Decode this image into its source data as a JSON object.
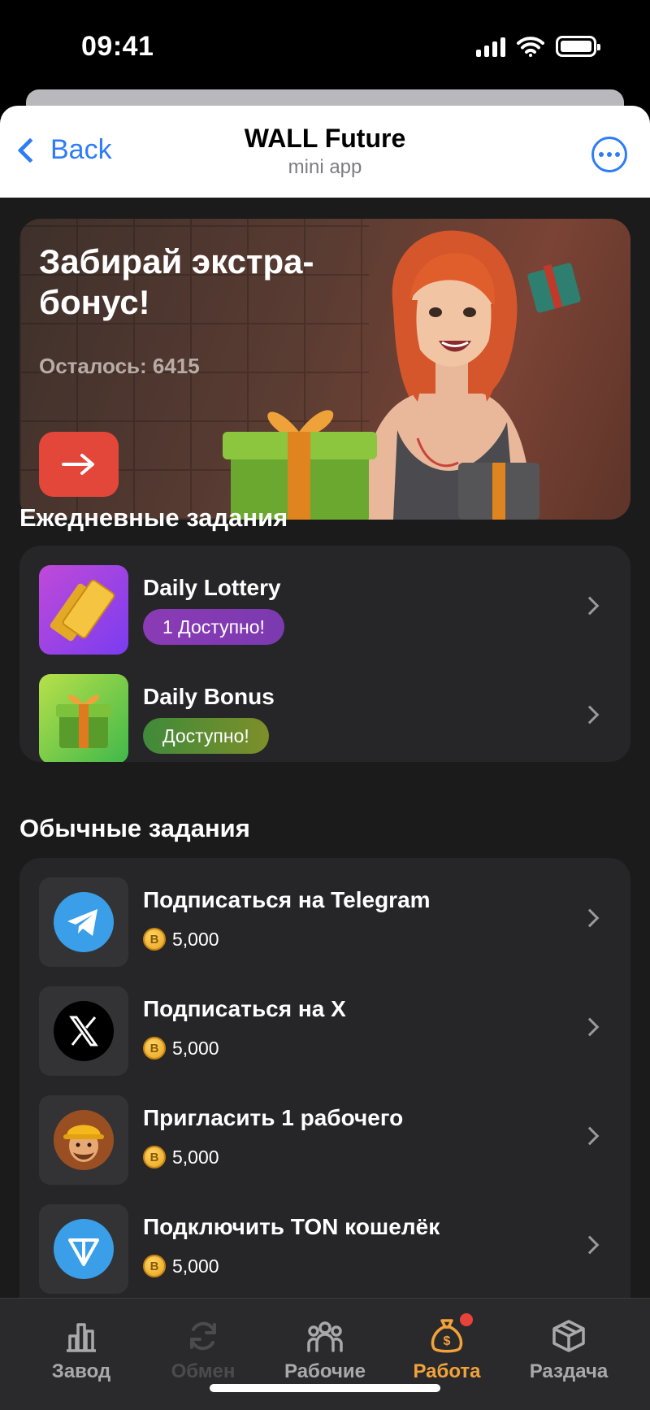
{
  "status_bar": {
    "time": "09:41"
  },
  "header": {
    "back_label": "Back",
    "title": "WALL Future",
    "subtitle": "mini app"
  },
  "banner": {
    "title": "Забирай экстра-бонус!",
    "remaining": "Осталось: 6415",
    "button_icon": "arrow-right-icon"
  },
  "daily": {
    "title": "Ежедневные задания",
    "items": [
      {
        "title": "Daily Lottery",
        "badge": "1 Доступно!",
        "icon": "lottery-tickets-icon"
      },
      {
        "title": "Daily Bonus",
        "badge": "Доступно!",
        "icon": "gift-box-icon"
      }
    ]
  },
  "regular": {
    "title": "Обычные задания",
    "items": [
      {
        "title": "Подписаться на Telegram",
        "reward": "5,000",
        "icon": "telegram-icon"
      },
      {
        "title": "Подписаться на X",
        "reward": "5,000",
        "icon": "x-logo-icon"
      },
      {
        "title": "Пригласить 1 рабочего",
        "reward": "5,000",
        "icon": "worker-avatar-icon"
      },
      {
        "title": "Подключить TON кошелёк",
        "reward": "5,000",
        "icon": "ton-wallet-icon"
      }
    ]
  },
  "coin_symbol": "B",
  "tabs": [
    {
      "label": "Завод",
      "icon": "factory-icon"
    },
    {
      "label": "Обмен",
      "icon": "exchange-icon",
      "state": "disabled"
    },
    {
      "label": "Рабочие",
      "icon": "workers-icon"
    },
    {
      "label": "Работа",
      "icon": "money-bag-icon",
      "state": "active"
    },
    {
      "label": "Раздача",
      "icon": "box-icon"
    }
  ],
  "colors": {
    "accent": "#f3a23a",
    "ios_blue": "#2e7cf6",
    "banner_button": "#e3473a",
    "notification_dot": "#e8433a"
  }
}
